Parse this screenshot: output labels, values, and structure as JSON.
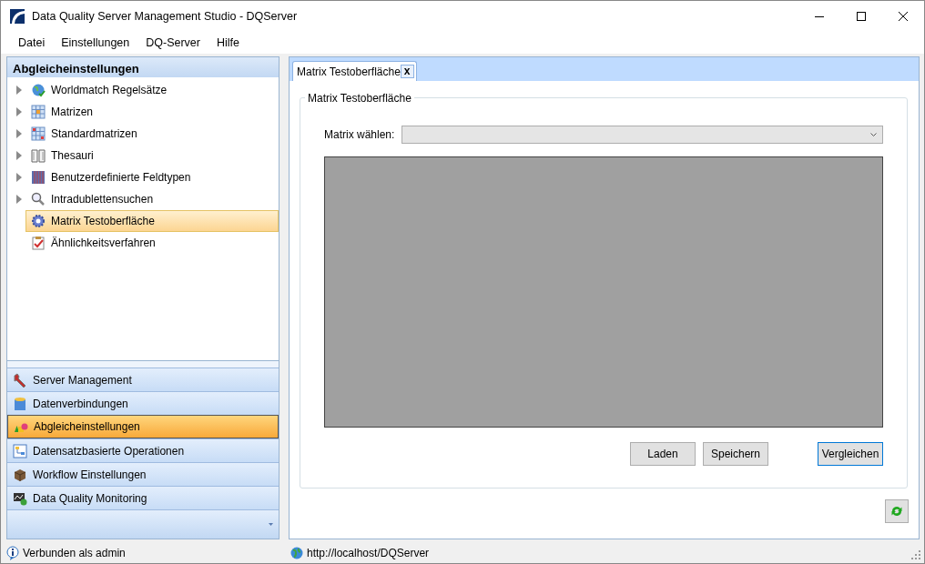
{
  "window": {
    "title": "Data Quality Server Management Studio - DQServer"
  },
  "menu": [
    "Datei",
    "Einstellungen",
    "DQ-Server",
    "Hilfe"
  ],
  "navigator": {
    "title": "Abgleicheinstellungen",
    "tree": [
      {
        "label": "Worldmatch Regelsätze",
        "expandable": true,
        "selected": false
      },
      {
        "label": "Matrizen",
        "expandable": true,
        "selected": false
      },
      {
        "label": "Standardmatrizen",
        "expandable": true,
        "selected": false
      },
      {
        "label": "Thesauri",
        "expandable": true,
        "selected": false
      },
      {
        "label": "Benutzerdefinierte Feldtypen",
        "expandable": true,
        "selected": false
      },
      {
        "label": "Intradublettensuchen",
        "expandable": true,
        "selected": false
      },
      {
        "label": "Matrix Testoberfläche",
        "expandable": false,
        "selected": true
      },
      {
        "label": "Ähnlichkeitsverfahren",
        "expandable": false,
        "selected": false
      }
    ],
    "sections": [
      {
        "label": "Server Management",
        "selected": false
      },
      {
        "label": "Datenverbindungen",
        "selected": false
      },
      {
        "label": "Abgleicheinstellungen",
        "selected": true
      },
      {
        "label": "Datensatzbasierte Operationen",
        "selected": false
      },
      {
        "label": "Workflow Einstellungen",
        "selected": false
      },
      {
        "label": "Data Quality Monitoring",
        "selected": false
      }
    ]
  },
  "tabs": [
    {
      "label": "Matrix Testoberfläche",
      "selected": true,
      "close": "x"
    }
  ],
  "group": {
    "title": "Matrix Testoberfläche",
    "field_label": "Matrix wählen:",
    "buttons": [
      {
        "label": "Laden",
        "focused": false
      },
      {
        "label": "Speichern",
        "focused": false
      },
      {
        "label": "Vergleichen",
        "focused": true
      }
    ]
  },
  "status_bar": {
    "connection": "Verbunden als admin",
    "url": "http://localhost/DQServer"
  }
}
